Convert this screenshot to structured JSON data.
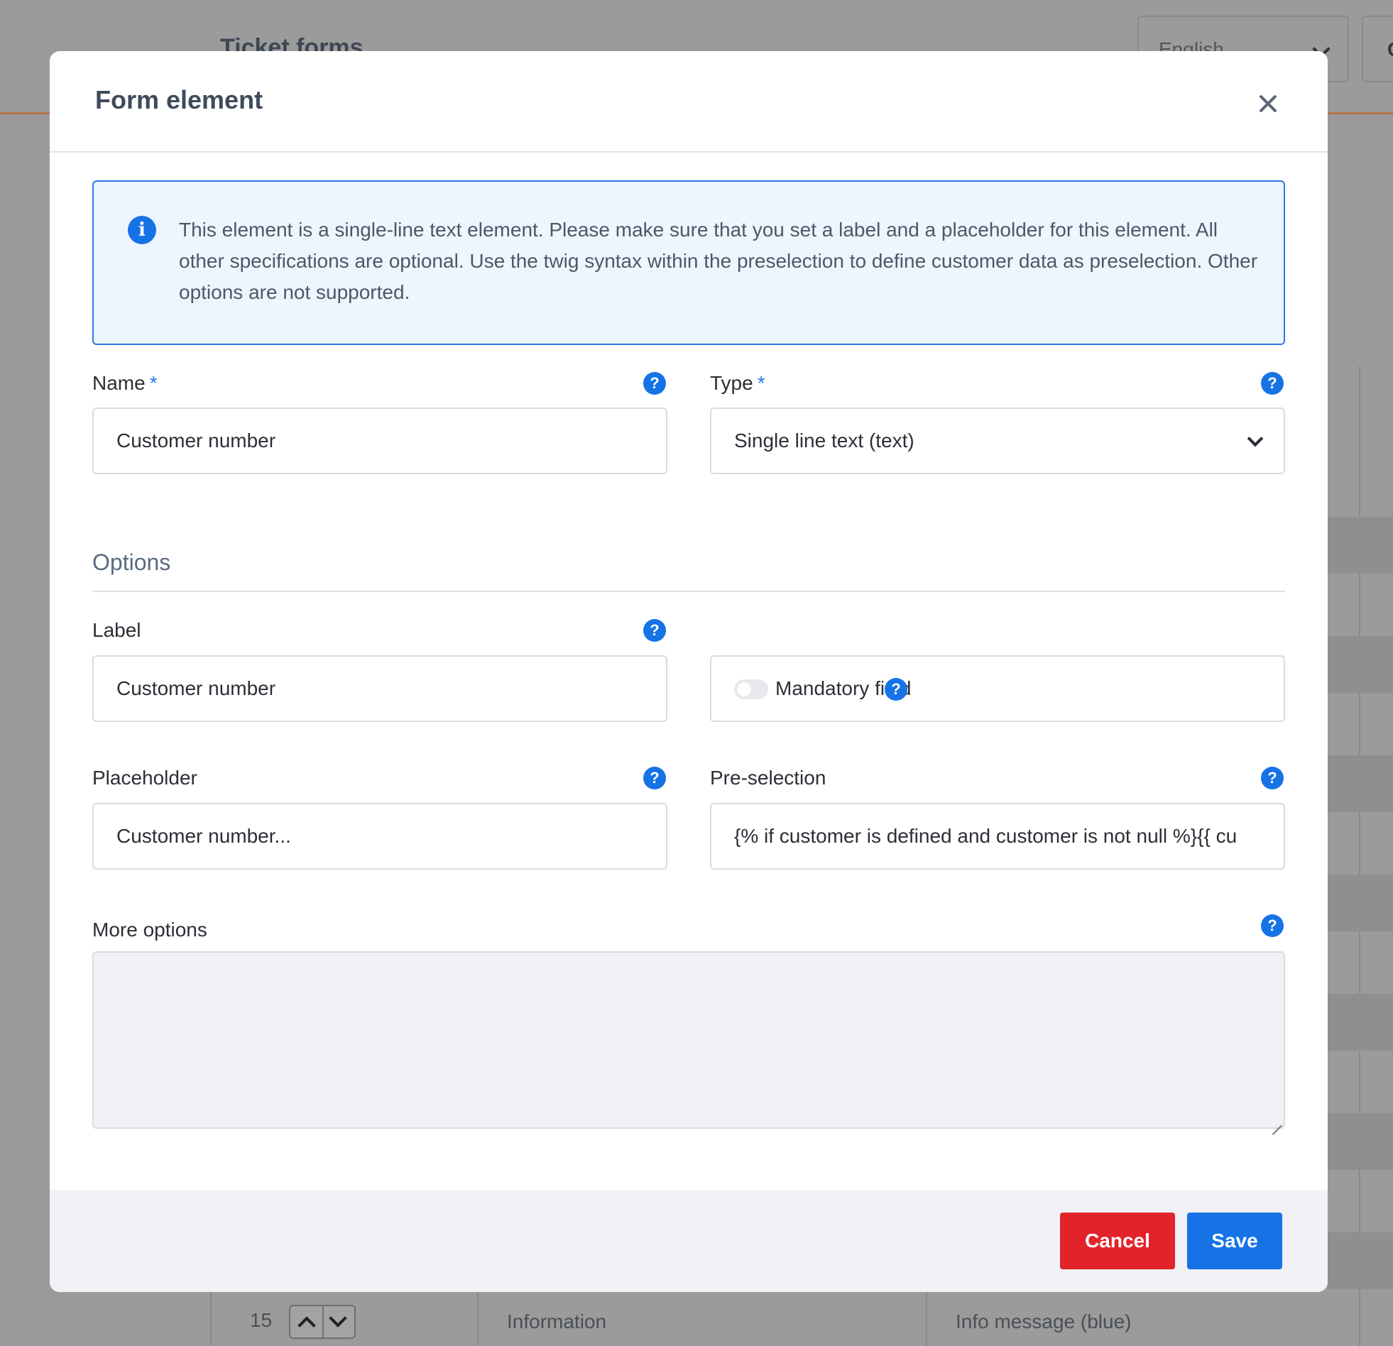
{
  "background": {
    "page_title": "Ticket forms",
    "language_select": "English",
    "button_partial": "C",
    "row": {
      "position": "15",
      "type": "Information",
      "style": "Info message (blue)"
    }
  },
  "modal": {
    "title": "Form element",
    "info_text": "This element is a single-line text element. Please make sure that you set a label and a placeholder for this element. All other specifications are optional. Use the twig syntax within the preselection to define customer data as preselection. Other options are not supported.",
    "name": {
      "label": "Name",
      "required_mark": "*",
      "value": "Customer number"
    },
    "type": {
      "label": "Type",
      "required_mark": "*",
      "value": "Single line text (text)"
    },
    "options_title": "Options",
    "label_field": {
      "label": "Label",
      "value": "Customer number"
    },
    "mandatory": {
      "label": "Mandatory field",
      "checked": false
    },
    "placeholder_field": {
      "label": "Placeholder",
      "value": "Customer number..."
    },
    "preselection": {
      "label": "Pre-selection",
      "value": "{% if customer is defined and customer is not null %}{{ cu"
    },
    "more_options": {
      "label": "More options",
      "value": ""
    },
    "help_glyph": "?",
    "info_glyph": "i",
    "buttons": {
      "cancel": "Cancel",
      "save": "Save"
    }
  }
}
